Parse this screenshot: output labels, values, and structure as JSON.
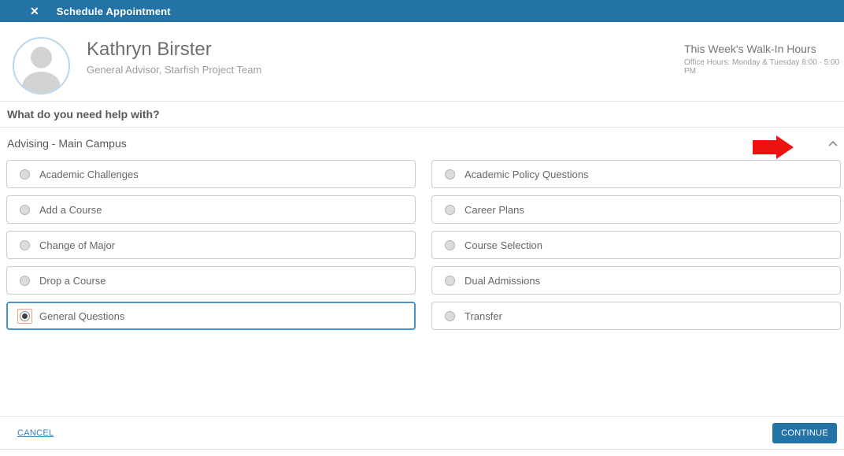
{
  "header": {
    "title": "Schedule Appointment",
    "close_glyph": "✕"
  },
  "advisor": {
    "name": "Kathryn Birster",
    "role": "General Advisor, Starfish Project Team"
  },
  "walkin": {
    "title": "This Week's Walk-In Hours",
    "hours": "Office Hours: Monday & Tuesday 8:00 - 5:00 PM"
  },
  "question": "What do you need help with?",
  "section": {
    "label": "Advising - Main Campus",
    "collapse_icon": "chevron-up-icon",
    "annotation": "red-arrow-right"
  },
  "options": [
    {
      "label": "Academic Challenges",
      "selected": false
    },
    {
      "label": "Academic Policy Questions",
      "selected": false
    },
    {
      "label": "Add a Course",
      "selected": false
    },
    {
      "label": "Career Plans",
      "selected": false
    },
    {
      "label": "Change of Major",
      "selected": false
    },
    {
      "label": "Course Selection",
      "selected": false
    },
    {
      "label": "Drop a Course",
      "selected": false
    },
    {
      "label": "Dual Admissions",
      "selected": false
    },
    {
      "label": "General Questions",
      "selected": true
    },
    {
      "label": "Transfer",
      "selected": false
    }
  ],
  "footer": {
    "cancel_label": "CANCEL",
    "continue_label": "CONTINUE"
  },
  "colors": {
    "header_blue": "#2473a7",
    "selected_border_blue": "#4c92c6",
    "focus_ring_orange": "#f0a184",
    "annotation_red": "#ee1111",
    "continue_blue": "#2473a7"
  }
}
